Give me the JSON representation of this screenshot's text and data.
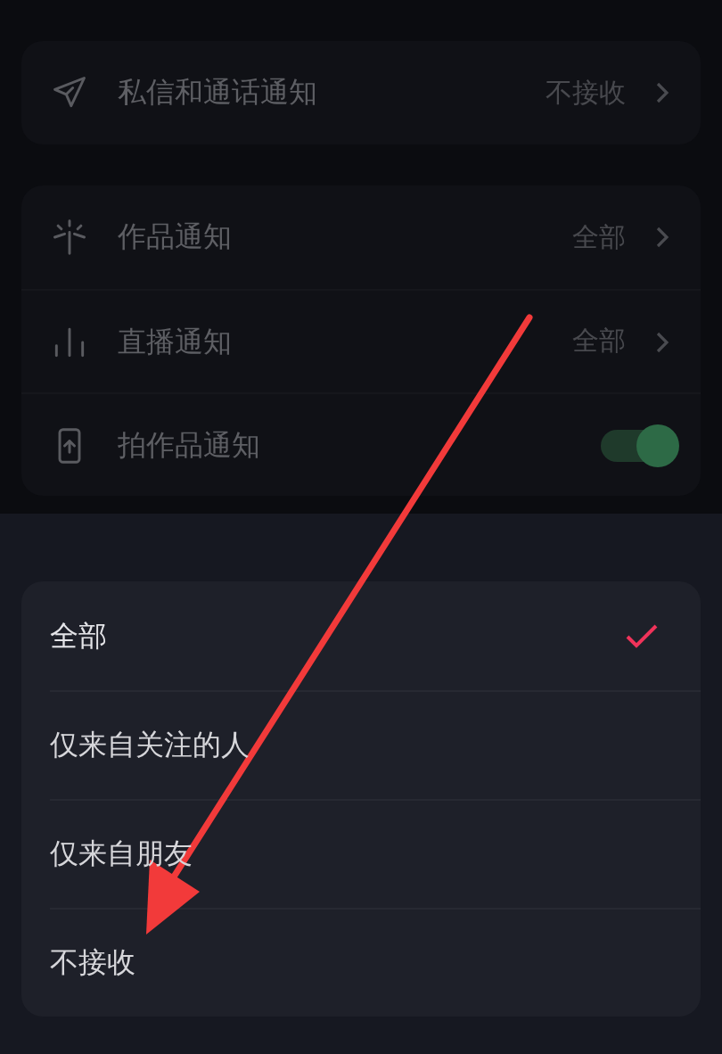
{
  "settings_groups": [
    {
      "items": [
        {
          "kind": "link",
          "label": "私信和通话通知",
          "value": "不接收"
        }
      ]
    },
    {
      "items": [
        {
          "kind": "link",
          "label": "作品通知",
          "value": "全部"
        },
        {
          "kind": "link",
          "label": "直播通知",
          "value": "全部"
        },
        {
          "kind": "toggle",
          "label": "拍作品通知",
          "on": true
        }
      ]
    }
  ],
  "sheet": {
    "options": [
      {
        "label": "全部",
        "selected": true
      },
      {
        "label": "仅来自关注的人",
        "selected": false
      },
      {
        "label": "仅来自朋友",
        "selected": false
      },
      {
        "label": "不接收",
        "selected": false
      }
    ]
  }
}
